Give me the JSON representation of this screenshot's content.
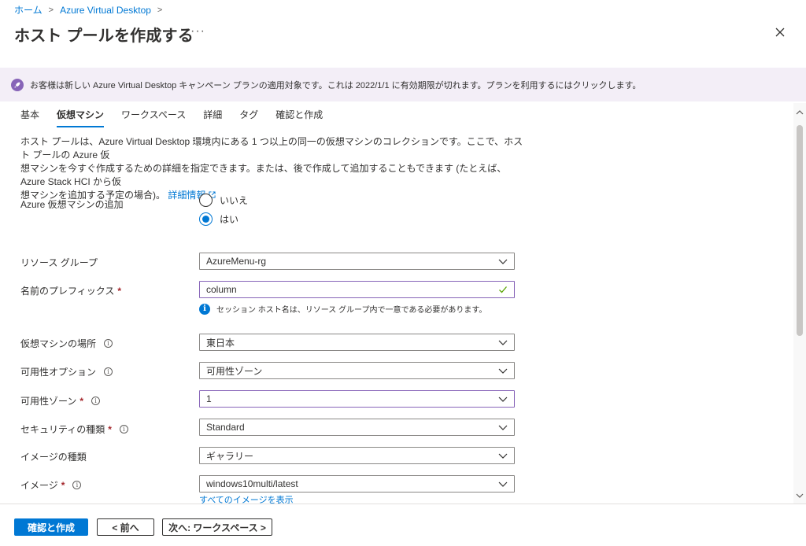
{
  "breadcrumb": {
    "home": "ホーム",
    "service": "Azure Virtual Desktop"
  },
  "header": {
    "title": "ホスト プールを作成する",
    "more": "···"
  },
  "banner": {
    "text": "お客様は新しい Azure Virtual Desktop キャンペーン プランの適用対象です。これは 2022/1/1 に有効期限が切れます。プランを利用するにはクリックします。",
    "accent": "#8764b8"
  },
  "tabs": [
    "基本",
    "仮想マシン",
    "ワークスペース",
    "詳細",
    "タグ",
    "確認と作成"
  ],
  "active_tab": "仮想マシン",
  "description": {
    "line1": "ホスト プールは、Azure Virtual Desktop 環境内にある 1 つ以上の同一の仮想マシンのコレクションです。ここで、ホスト プールの Azure 仮",
    "line2": "想マシンを今すぐ作成するための詳細を指定できます。または、後で作成して追加することもできます (たとえば、Azure Stack HCI から仮",
    "line3": "想マシンを追加する予定の場合)。",
    "link": "詳細情報"
  },
  "form": {
    "add_vm": {
      "label": "Azure 仮想マシンの追加",
      "options": [
        "いいえ",
        "はい"
      ],
      "selected": "はい"
    },
    "resource_group": {
      "label": "リソース グループ",
      "value": "AzureMenu-rg"
    },
    "name_prefix": {
      "label": "名前のプレフィックス",
      "required": "*",
      "value": "column",
      "hint": "セッション ホスト名は、リソース グループ内で一意である必要があります。"
    },
    "vm_location": {
      "label": "仮想マシンの場所",
      "value": "東日本"
    },
    "availability_option": {
      "label": "可用性オプション",
      "value": "可用性ゾーン"
    },
    "availability_zone": {
      "label": "可用性ゾーン",
      "required": "*",
      "value": "1"
    },
    "security_type": {
      "label": "セキュリティの種類",
      "required": "*",
      "value": "Standard"
    },
    "image_type": {
      "label": "イメージの種類",
      "value": "ギャラリー"
    },
    "image": {
      "label": "イメージ",
      "required": "*",
      "value": "windows10multi/latest",
      "link": "すべてのイメージを表示"
    }
  },
  "footer": {
    "review": "確認と作成",
    "prev": "< 前へ",
    "next": "次へ: ワークスペース >"
  },
  "colors": {
    "primary": "#0078d4",
    "focus_border": "#8764b8",
    "required": "#a4262c",
    "success_check": "#57a300"
  }
}
